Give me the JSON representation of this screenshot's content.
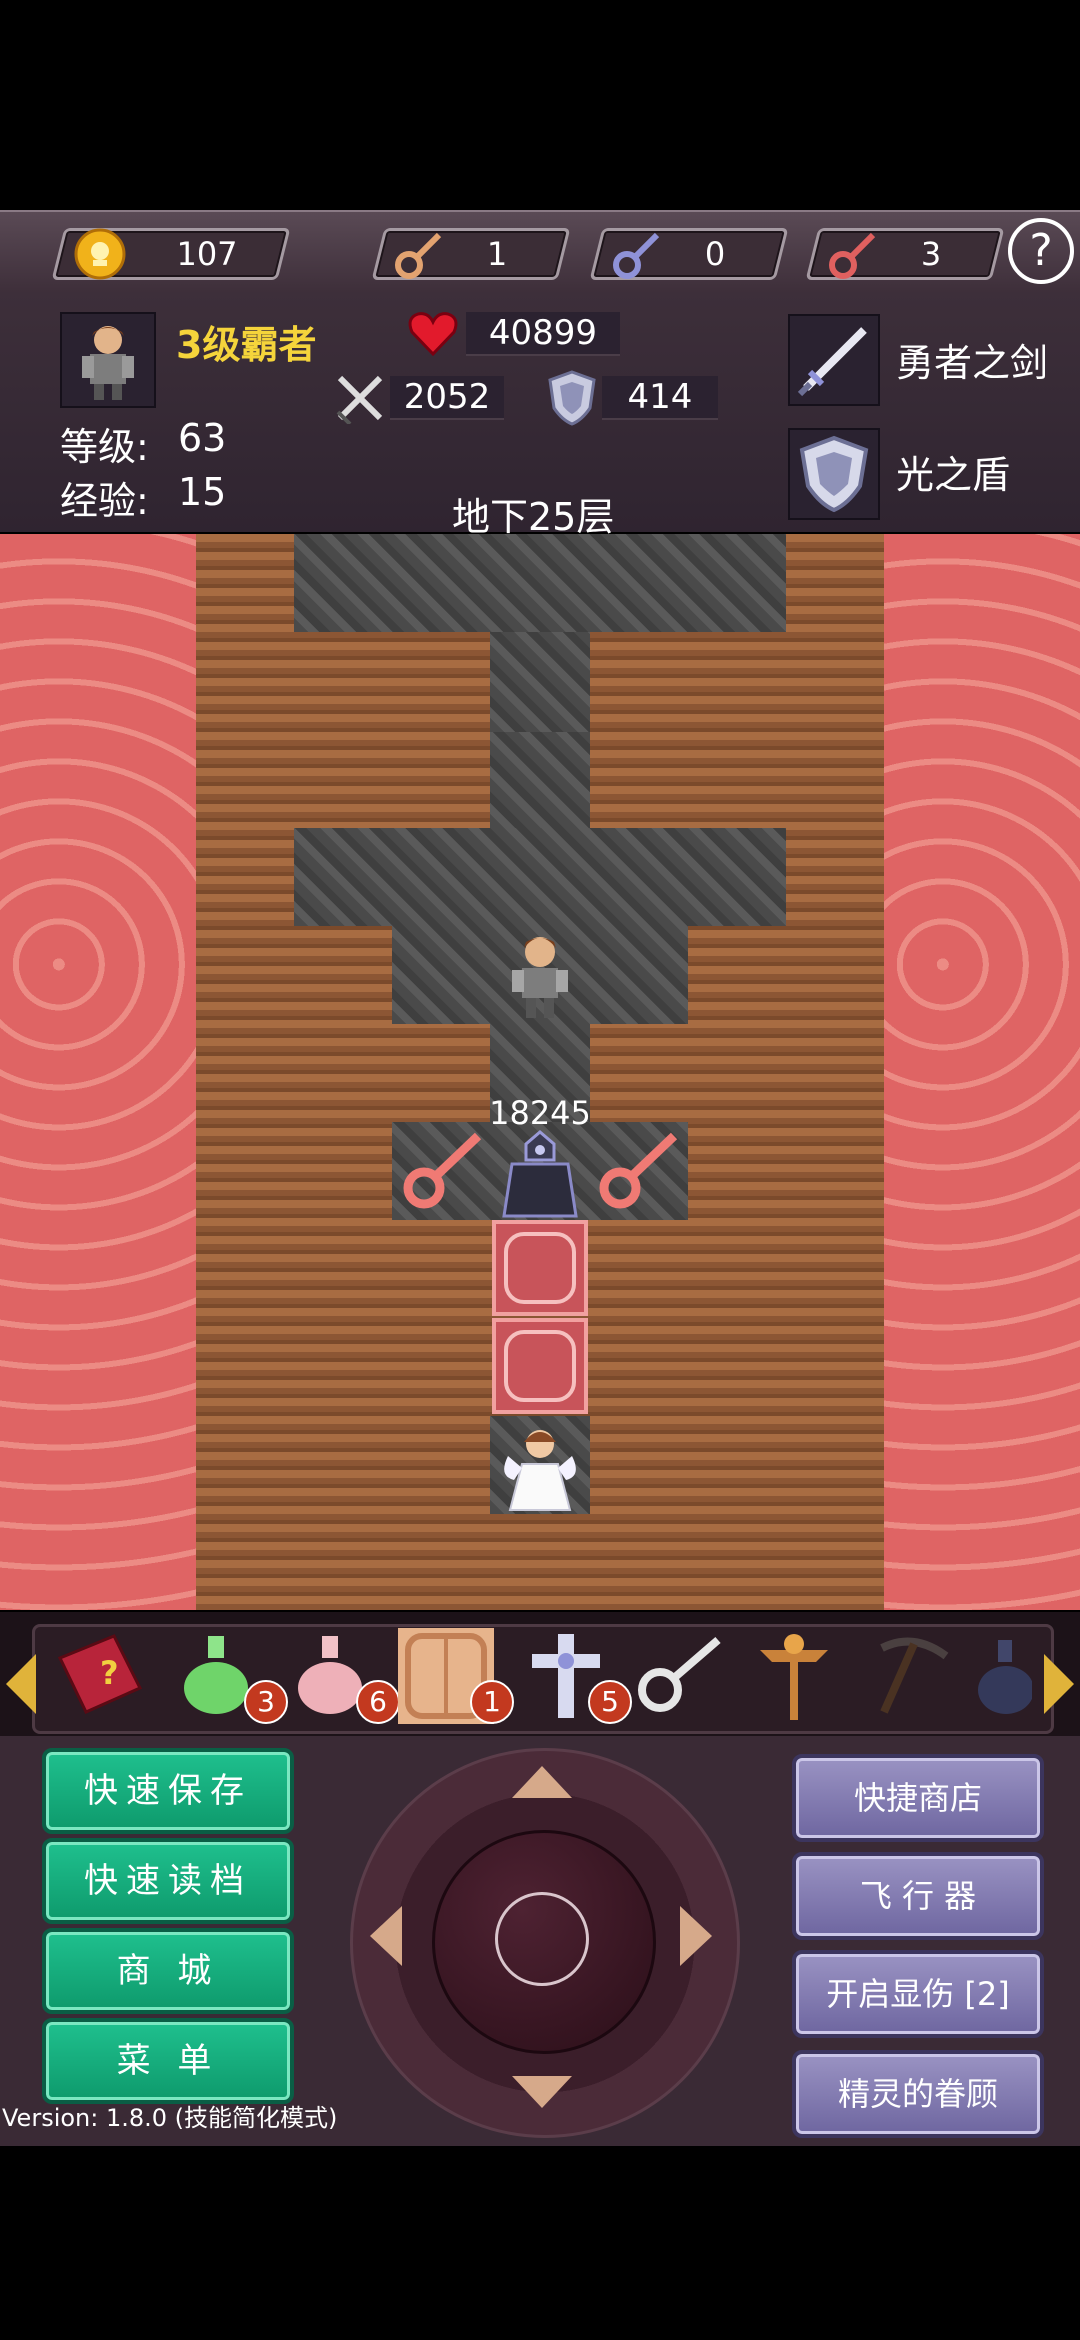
{
  "resources": {
    "gold": "107",
    "yellow_keys": "1",
    "blue_keys": "0",
    "red_keys": "3",
    "help_label": "?"
  },
  "hero": {
    "title": "3级霸者",
    "hp": "40899",
    "attack": "2052",
    "defense": "414",
    "level_label": "等级:",
    "level": "63",
    "exp_label": "经验:",
    "exp": "15"
  },
  "equipment": {
    "weapon": "勇者之剑",
    "shield": "光之盾"
  },
  "floor": "地下25层",
  "enemy_damage": "18245",
  "items": [
    {
      "name": "monster-manual",
      "count": ""
    },
    {
      "name": "green-potion",
      "count": "3"
    },
    {
      "name": "pink-potion",
      "count": "6"
    },
    {
      "name": "door-item",
      "count": "1"
    },
    {
      "name": "holy-cross",
      "count": "5"
    },
    {
      "name": "key-item",
      "count": ""
    },
    {
      "name": "staff-item",
      "count": ""
    },
    {
      "name": "pickaxe-item",
      "count": ""
    },
    {
      "name": "blue-potion",
      "count": ""
    }
  ],
  "buttons_left": [
    "快速保存",
    "快速读档",
    "商 城",
    "菜 单"
  ],
  "buttons_right": [
    "快捷商店",
    "飞 行 器",
    "开启显伤 [2]",
    "精灵的眷顾"
  ],
  "version": "Version: 1.8.0 (技能简化模式)",
  "colors": {
    "title_gold": "#f5d43b",
    "key_yellow": "#e3a370",
    "key_blue": "#8f92d8",
    "key_red": "#e0605f",
    "badge_red": "#c3391f",
    "green_button": "#13a878",
    "purple_button": "#8079b3",
    "lava": "#df6464"
  }
}
